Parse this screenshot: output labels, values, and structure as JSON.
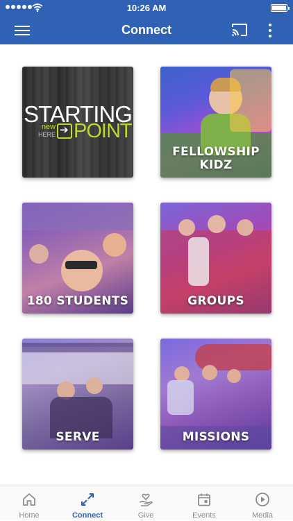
{
  "status_bar": {
    "time": "10:26 AM"
  },
  "app_bar": {
    "title": "Connect"
  },
  "tiles": [
    {
      "label": "",
      "logo": {
        "line1": "STARTING",
        "new": "new",
        "here": "HERE",
        "point": "POINT"
      }
    },
    {
      "label": "FELLOWSHIP\nKIDZ"
    },
    {
      "label": "180 STUDENTS"
    },
    {
      "label": "GROUPS"
    },
    {
      "label": "SERVE"
    },
    {
      "label": "MISSIONS"
    }
  ],
  "tab_bar": {
    "items": [
      {
        "label": "Home",
        "icon": "home-icon",
        "active": false
      },
      {
        "label": "Connect",
        "icon": "connect-icon",
        "active": true
      },
      {
        "label": "Give",
        "icon": "give-icon",
        "active": false
      },
      {
        "label": "Events",
        "icon": "calendar-icon",
        "active": false
      },
      {
        "label": "Media",
        "icon": "play-icon",
        "active": false
      }
    ]
  },
  "colors": {
    "brand": "#2f62b5",
    "accent_green": "#bfd730",
    "tab_inactive": "#8e8e8e"
  }
}
